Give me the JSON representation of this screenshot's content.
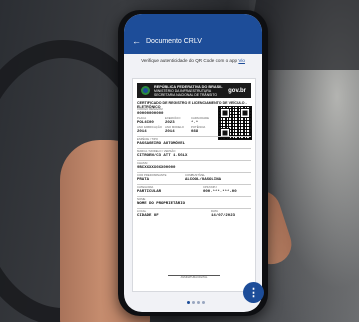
{
  "app": {
    "title": "Documento CRLV",
    "back_icon": "arrow-left-icon",
    "verify_text": "Verifique autenticidade do QR Code com o app",
    "verify_link": "Vio",
    "colors": {
      "primary": "#1d4d99",
      "banner": "#1b1b1b"
    }
  },
  "document": {
    "republic_line1": "REPÚBLICA FEDERATIVA DO BRASIL",
    "republic_line2": "MINISTÉRIO DA INFRAESTRUTURA",
    "republic_line3": "SECRETARIA NACIONAL DE TRÂNSITO",
    "gov_logo": "gov.br",
    "title": "CERTIFICADO DE REGISTRO E LICENCIAMENTO DE VEÍCULO - ELETRÔNICO",
    "fields": [
      {
        "label": "CÓDIGO RENAVAM",
        "value": "00000000000"
      },
      {
        "label": "PLACA",
        "value": "POL4C00"
      },
      {
        "label": "EXERCÍCIO",
        "value": "2023"
      },
      {
        "label": "ANO FABRICAÇÃO",
        "value": "2014"
      },
      {
        "label": "ANO MODELO",
        "value": "2014"
      },
      {
        "label": "CAPACIDADE",
        "value": "*.*"
      },
      {
        "label": "POTÊNCIA",
        "value": "088"
      },
      {
        "label": "ESPÉCIE / TIPO",
        "value": "PASSAGEIRO AUTOMÓVEL"
      },
      {
        "label": "MARCA / MODELO / VERSÃO",
        "value": "CITROEN/C3 ATT 1.5GLX"
      },
      {
        "label": "CHASSI",
        "value": "9BCXXXXX0XX00000"
      },
      {
        "label": "COR PREDOMINANTE",
        "value": "PRATA"
      },
      {
        "label": "COMBUSTÍVEL",
        "value": "ALCOOL/GASOLINA"
      },
      {
        "label": "CATEGORIA",
        "value": "PARTICULAR"
      },
      {
        "label": "CPF/CNPJ",
        "value": "000.***.***-00"
      },
      {
        "label": "NOME",
        "value": "NOME DO PROPRIETÁRIO"
      },
      {
        "label": "LOCAL",
        "value": "CIDADE UF"
      },
      {
        "label": "DATA",
        "value": "14/07/2023"
      }
    ],
    "signature_caption": "ASSINATURA DIGITAL"
  },
  "pager": {
    "count": 4,
    "active": 0
  },
  "fab": {
    "icon": "more-vertical-icon",
    "glyph": "⋮"
  }
}
